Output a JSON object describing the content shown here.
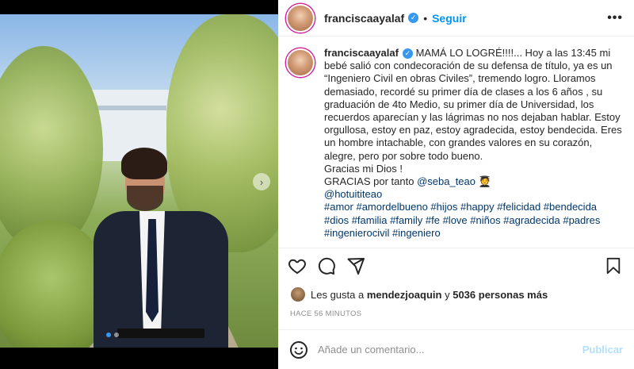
{
  "post": {
    "username": "franciscaayalaf",
    "follow_label": "Seguir",
    "separator": "•",
    "more_label": "•••",
    "verified_glyph": "✓"
  },
  "caption": {
    "username": "franciscaayalaf",
    "text": "MAMÁ LO LOGRÉ!!!!... Hoy a las 13:45 mi bebé salió con condecoración de su defensa de título, ya es un “Ingeniero Civil en obras Civiles”, tremendo logro. Lloramos demasiado, recordé su primer día de clases a los 6 años , su graduación de 4to Medio, su primer día de Universidad, los recuerdos aparecían y las lágrimas no nos dejaban hablar. Estoy orgullosa, estoy en paz, estoy agradecida, estoy bendecida. Eres un hombre intachable, con grandes valores en su corazón, alegre, pero por sobre todo bueno.",
    "line_thanks": "Gracias mi Dios !",
    "line_gracias_prefix": "GRACIAS por tanto",
    "mention_seba": "@seba_teao",
    "grad_emoji": "🧑‍🎓",
    "mention_hotu": "@hotuititeao",
    "hashtags": "#amor #amordelbueno #hijos #happy #felicidad #bendecida #dios #familia #family #fe #love #niños #agradecida #padres #ingenierocivil #ingeniero"
  },
  "likes": {
    "prefix": "Les gusta a",
    "user": "mendezjoaquin",
    "conjunction": "y",
    "count_label": "5036 personas más"
  },
  "timestamp": "HACE 56 MINUTOS",
  "comment": {
    "placeholder": "Añade un comentario...",
    "post_label": "Publicar"
  },
  "carousel": {
    "next_glyph": "›",
    "slide_count": 2,
    "active_index": 0
  },
  "icons": [
    "heart-icon",
    "comment-icon",
    "share-icon",
    "bookmark-icon",
    "emoji-icon",
    "verified-icon",
    "more-icon",
    "chevron-right-icon"
  ],
  "colors": {
    "link_blue": "#0095f6",
    "mention_blue": "#00376b",
    "muted": "#8e8e8e",
    "disabled_blue": "#b2dffc",
    "text": "#262626"
  }
}
